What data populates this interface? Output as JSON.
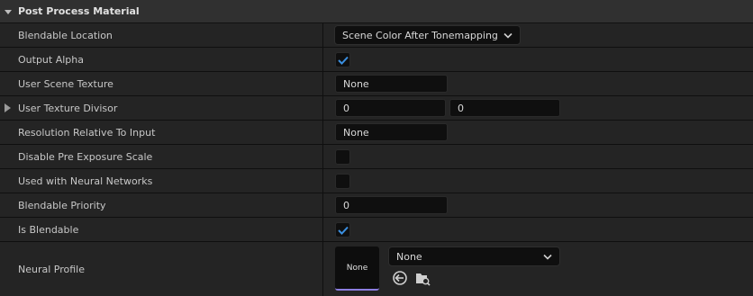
{
  "section": {
    "title": "Post Process Material",
    "icon": "chevron-down-icon"
  },
  "rows": {
    "blendable_location": {
      "label": "Blendable Location",
      "value": "Scene Color After Tonemapping"
    },
    "output_alpha": {
      "label": "Output Alpha",
      "checked": true
    },
    "user_scene_texture": {
      "label": "User Scene Texture",
      "value": "None"
    },
    "user_texture_divisor": {
      "label": "User Texture Divisor",
      "x": "0",
      "y": "0"
    },
    "resolution_relative": {
      "label": "Resolution Relative To Input",
      "value": "None"
    },
    "disable_pre_exposure": {
      "label": "Disable Pre Exposure Scale",
      "checked": false
    },
    "used_with_neural": {
      "label": "Used with Neural Networks",
      "checked": false
    },
    "blendable_priority": {
      "label": "Blendable Priority",
      "value": "0"
    },
    "is_blendable": {
      "label": "Is Blendable",
      "checked": true
    },
    "neural_profile": {
      "label": "Neural Profile",
      "thumbnail": "None",
      "asset": "None"
    }
  },
  "colors": {
    "accent_check": "#3b8fe0",
    "thumbnail_underline": "#8c7de0"
  }
}
